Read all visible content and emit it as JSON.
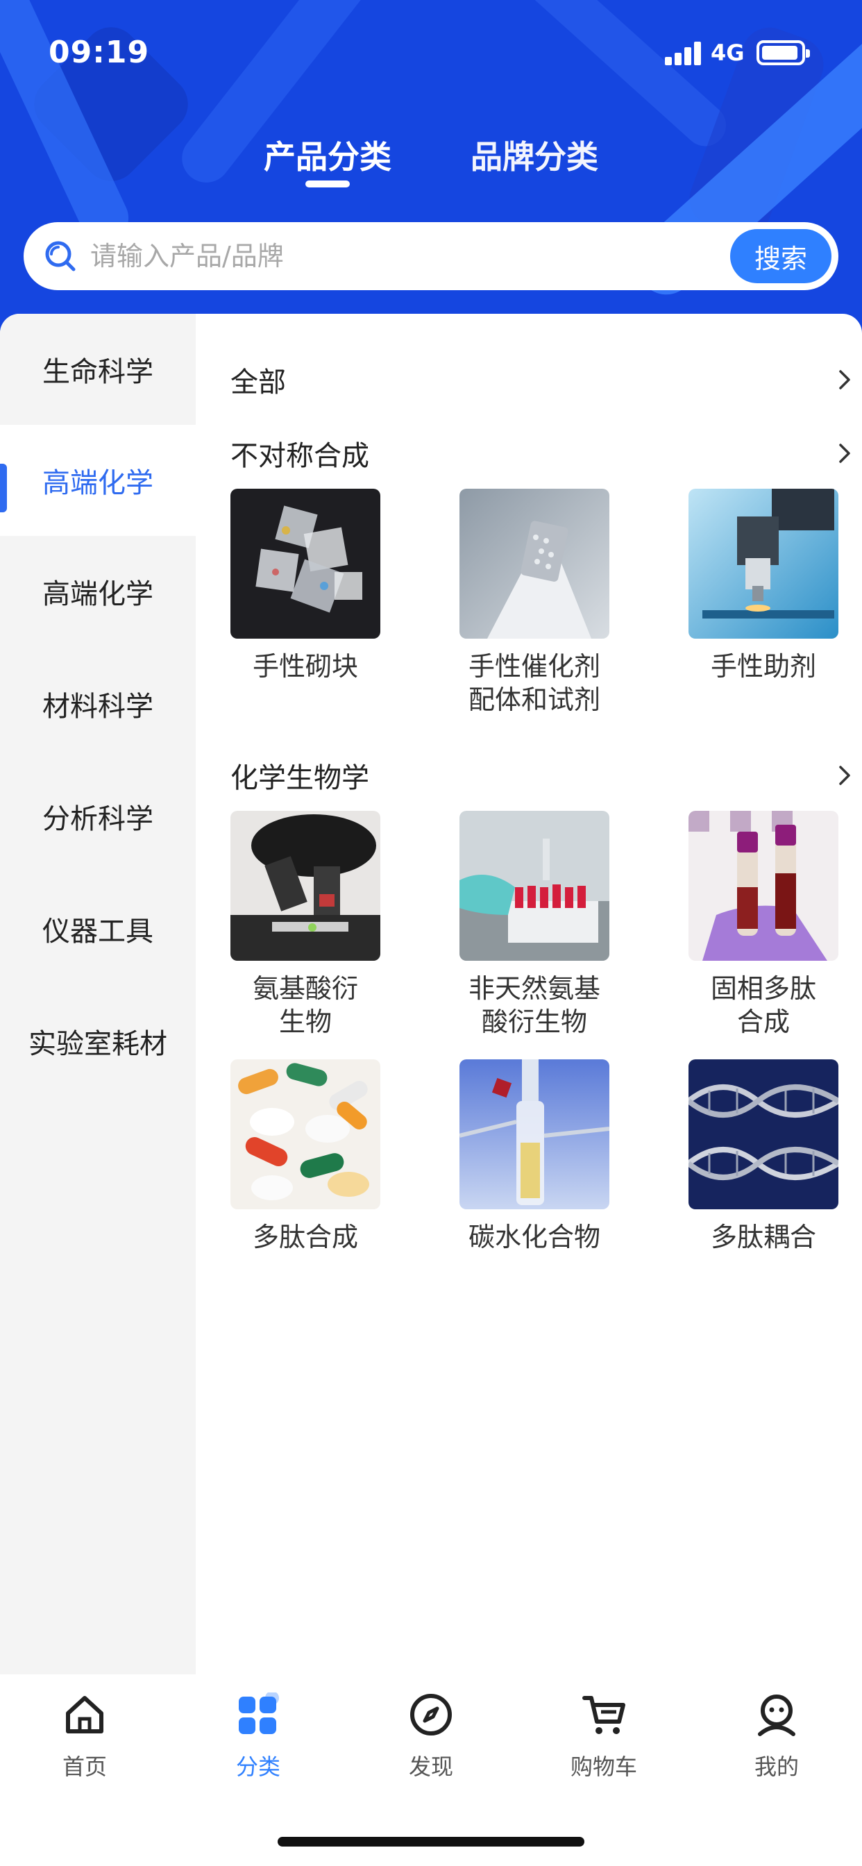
{
  "status": {
    "time": "09:19",
    "network": "4G",
    "battery_level": 0.95
  },
  "top_tabs": [
    {
      "label": "产品分类",
      "active": true
    },
    {
      "label": "品牌分类",
      "active": false
    }
  ],
  "search": {
    "placeholder": "请输入产品/品牌",
    "button_label": "搜索"
  },
  "sidebar": {
    "items": [
      {
        "label": "生命科学",
        "active": false
      },
      {
        "label": "高端化学",
        "active": true
      },
      {
        "label": "高端化学",
        "active": false
      },
      {
        "label": "材料科学",
        "active": false
      },
      {
        "label": "分析科学",
        "active": false
      },
      {
        "label": "仪器工具",
        "active": false
      },
      {
        "label": "实验室耗材",
        "active": false
      }
    ]
  },
  "content": {
    "all_label": "全部",
    "sections": [
      {
        "title": "不对称合成",
        "items": [
          {
            "label": "手性砌块",
            "image": "chiral-building-block-image"
          },
          {
            "label": "手性催化剂\n配体和试剂",
            "image": "chiral-catalyst-image"
          },
          {
            "label": "手性助剂",
            "image": "microscope-image"
          }
        ]
      },
      {
        "title": "化学生物学",
        "items": [
          {
            "label": "氨基酸衍\n生物",
            "image": "microscope-closeup-image"
          },
          {
            "label": "非天然氨基\n酸衍生物",
            "image": "test-tubes-image"
          },
          {
            "label": "固相多肽\n合成",
            "image": "blood-tubes-image"
          },
          {
            "label": "多肽合成",
            "image": "pills-image"
          },
          {
            "label": "碳水化合物",
            "image": "lab-apparatus-image"
          },
          {
            "label": "多肽耦合",
            "image": "dna-helix-image"
          }
        ]
      }
    ]
  },
  "bottom_nav": [
    {
      "label": "首页",
      "icon": "home-icon",
      "active": false
    },
    {
      "label": "分类",
      "icon": "category-icon",
      "active": true
    },
    {
      "label": "发现",
      "icon": "compass-icon",
      "active": false
    },
    {
      "label": "购物车",
      "icon": "cart-icon",
      "active": false
    },
    {
      "label": "我的",
      "icon": "profile-icon",
      "active": false
    }
  ],
  "colors": {
    "brand_blue": "#1546e0",
    "accent": "#2f80ff",
    "active_text": "#2f6bf0"
  }
}
